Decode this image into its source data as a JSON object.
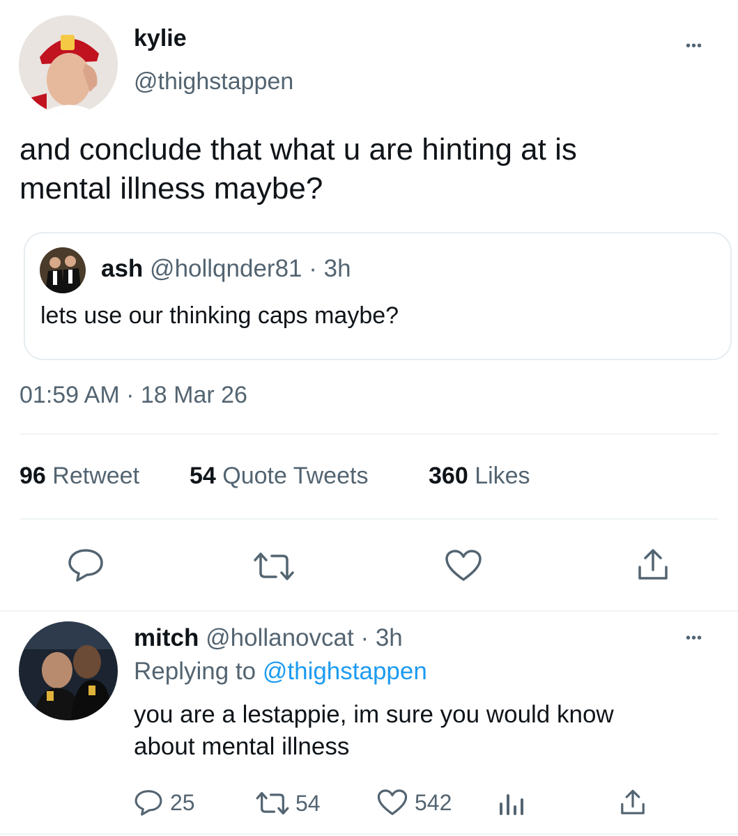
{
  "main_tweet": {
    "author_name": "kylie",
    "author_handle": "@thighstappen",
    "text_line1": "and conclude that what u are hinting at is",
    "text_line2": "mental illness maybe?",
    "timestamp": "01:59 AM · 18 Mar 26",
    "more_label": "•••"
  },
  "quoted_tweet": {
    "author_name": "ash",
    "author_handle": "@hollqnder81",
    "time": "· 3h",
    "text": "lets use our thinking caps maybe?"
  },
  "stats": {
    "retweets_count": "96",
    "retweets_label": "Retweet",
    "quotes_count": "54",
    "quotes_label": "Quote Tweets",
    "likes_count": "360",
    "likes_label": "Likes"
  },
  "action_icons": [
    "reply-icon",
    "retweet-icon",
    "like-icon",
    "share-icon"
  ],
  "reply": {
    "author_name": "mitch",
    "author_handle": "@hollanovcat",
    "time": "· 3h",
    "replying_prefix": "Replying to",
    "replying_handle": "@thighstappen",
    "text_line1": "you are a lestappie, im sure you would know",
    "text_line2": "about mental illness",
    "reply_count": "25",
    "retweet_count": "54",
    "like_count": "542",
    "more_label": "•••"
  },
  "colors": {
    "text": "#0f1419",
    "muted": "#536471",
    "link": "#1d9bf0",
    "border": "#eff3f4"
  }
}
